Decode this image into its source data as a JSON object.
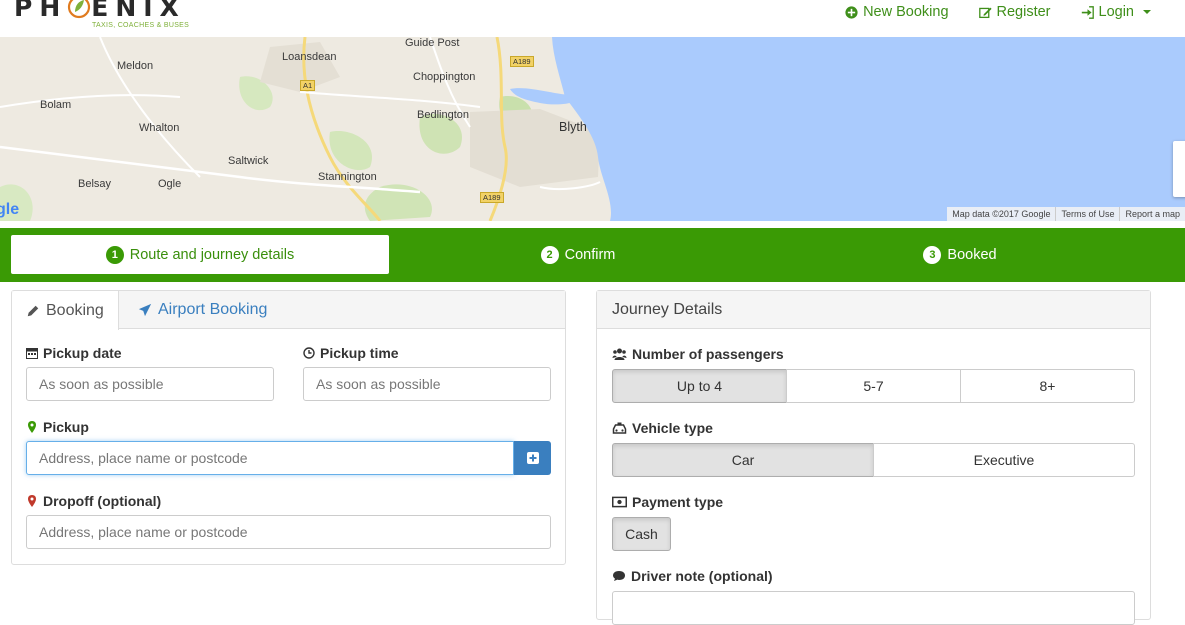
{
  "brand": {
    "name_pre": "PH",
    "name_post": "ENIX",
    "tagline": "TAXIS, COACHES & BUSES"
  },
  "nav": {
    "new_booking": "New Booking",
    "register": "Register",
    "login": "Login"
  },
  "map": {
    "places": [
      "Guide Post",
      "Meldon",
      "Loansdean",
      "Choppington",
      "Bolam",
      "Bedlington",
      "Blyth",
      "Whalton",
      "Saltwick",
      "Stannington",
      "Belsay",
      "Ogle"
    ],
    "roads": [
      "A189",
      "A1",
      "A189"
    ],
    "google": "gle",
    "footer": [
      "Map data ©2017 Google",
      "Terms of Use",
      "Report a map"
    ]
  },
  "steps": [
    {
      "num": "1",
      "label": "Route and journey details"
    },
    {
      "num": "2",
      "label": "Confirm"
    },
    {
      "num": "3",
      "label": "Booked"
    }
  ],
  "booking": {
    "tab_booking": "Booking",
    "tab_airport": "Airport Booking",
    "pickup_date_label": "Pickup date",
    "pickup_date_placeholder": "As soon as possible",
    "pickup_time_label": "Pickup time",
    "pickup_time_placeholder": "As soon as possible",
    "pickup_label": "Pickup",
    "pickup_placeholder": "Address, place name or postcode",
    "dropoff_label": "Dropoff (optional)",
    "dropoff_placeholder": "Address, place name or postcode"
  },
  "journey": {
    "heading": "Journey Details",
    "passengers_label": "Number of passengers",
    "passenger_options": [
      "Up to 4",
      "5-7",
      "8+"
    ],
    "vehicle_label": "Vehicle type",
    "vehicle_options": [
      "Car",
      "Executive"
    ],
    "payment_label": "Payment type",
    "payment_option": "Cash",
    "note_label": "Driver note (optional)"
  },
  "colors": {
    "brand_green": "#3a9a05",
    "link_blue": "#3a7fbf",
    "sea": "#aacbfd"
  }
}
